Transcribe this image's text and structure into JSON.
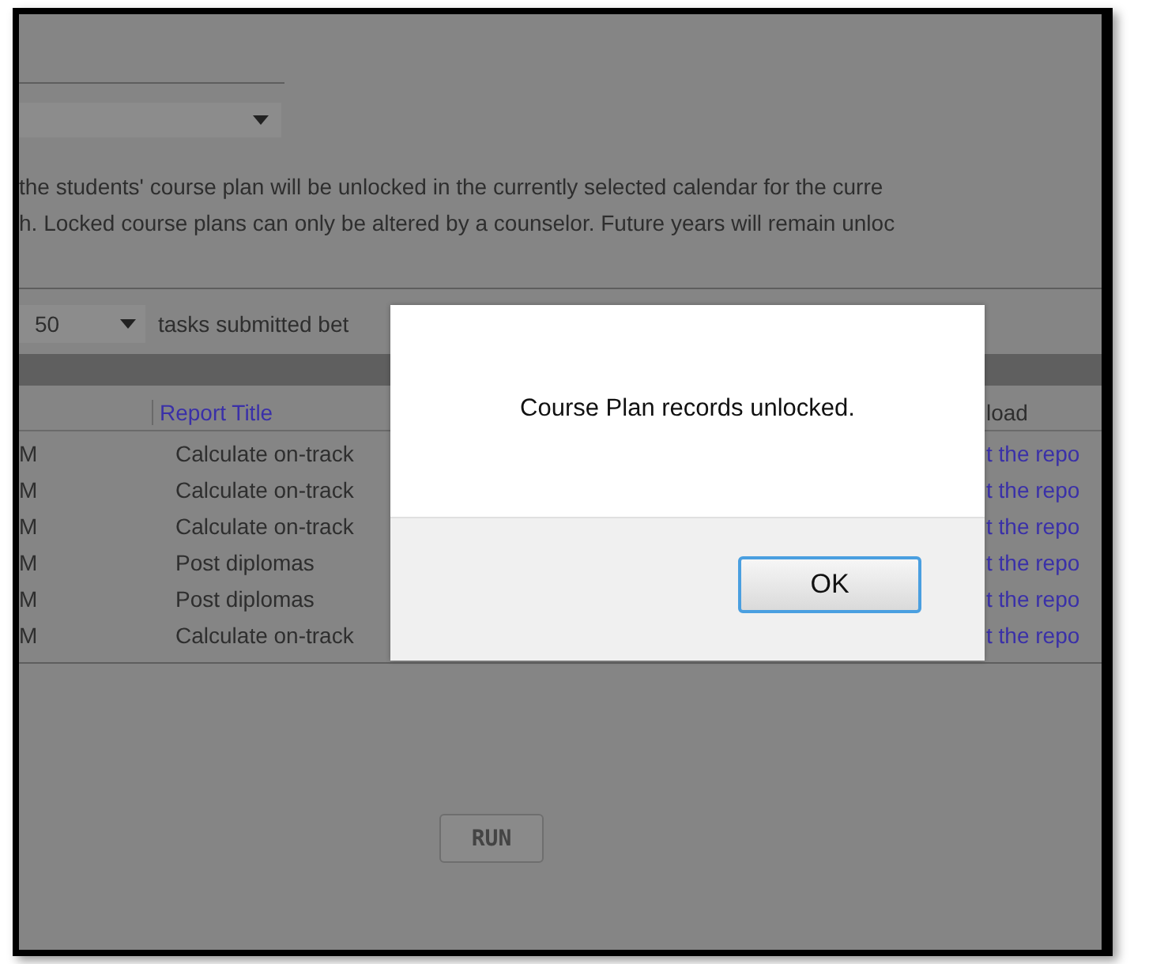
{
  "description": [
    "the students' course plan will be unlocked in the currently selected calendar for the curre",
    "h. Locked course plans can only be altered by a counselor. Future years will remain unloc"
  ],
  "page_size": {
    "value": "50"
  },
  "tasks_label": "tasks submitted bet",
  "table": {
    "columns": [
      "Report Title",
      "load"
    ],
    "rows": [
      {
        "column_1": "M",
        "report_title": "Calculate on-track",
        "column_3": "t the repo"
      },
      {
        "column_1": "M",
        "report_title": "Calculate on-track",
        "column_3": "t the repo"
      },
      {
        "column_1": "M",
        "report_title": "Calculate on-track",
        "column_3": "t the repo"
      },
      {
        "column_1": "M",
        "report_title": "Post diplomas",
        "column_3": "t the repo"
      },
      {
        "column_1": "M",
        "report_title": "Post diplomas",
        "column_3": "t the repo"
      },
      {
        "column_1": "M",
        "report_title": "Calculate on-track",
        "column_3": "t the repo"
      }
    ]
  },
  "run_button": {
    "label": "RUN",
    "disabled": true
  },
  "dialog": {
    "message": "Course Plan records unlocked.",
    "button": "OK"
  }
}
